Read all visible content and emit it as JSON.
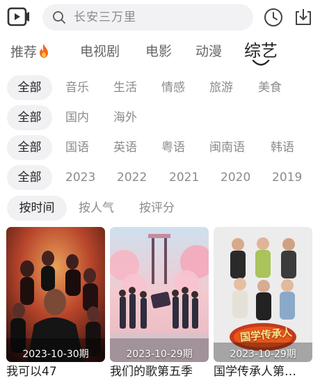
{
  "search": {
    "placeholder_text": "长安三万里"
  },
  "icons": {
    "logo": "video-play-icon",
    "search": "search-icon",
    "history": "clock-icon",
    "download": "download-icon",
    "fire": "fire-icon"
  },
  "tabs": [
    {
      "label": "推荐",
      "active": false
    },
    {
      "label": "电视剧",
      "active": false
    },
    {
      "label": "电影",
      "active": false
    },
    {
      "label": "动漫",
      "active": false
    },
    {
      "label": "综艺",
      "active": true
    }
  ],
  "filters": {
    "type": {
      "selected": "全部",
      "options": [
        "音乐",
        "生活",
        "情感",
        "旅游",
        "美食"
      ]
    },
    "region": {
      "selected": "全部",
      "options": [
        "国内",
        "海外"
      ]
    },
    "language": {
      "selected": "全部",
      "options": [
        "国语",
        "英语",
        "粤语",
        "闽南语",
        "韩语"
      ]
    },
    "year": {
      "selected": "全部",
      "options": [
        "2023",
        "2022",
        "2021",
        "2020",
        "2019"
      ]
    },
    "sort": {
      "selected": "按时间",
      "options": [
        "按人气",
        "按评分"
      ]
    }
  },
  "cards": [
    {
      "date": "2023-10-30期",
      "title": "我可以47"
    },
    {
      "date": "2023-10-29期",
      "title": "我们的歌第五季"
    },
    {
      "date": "2023-10-29期",
      "title": "国学传承人第…",
      "poster_text": "国学传承人"
    }
  ],
  "colors": {
    "chip_bg": "#f1f1f3",
    "search_bg": "#f2f2f4",
    "fire": "#f36b1c"
  }
}
